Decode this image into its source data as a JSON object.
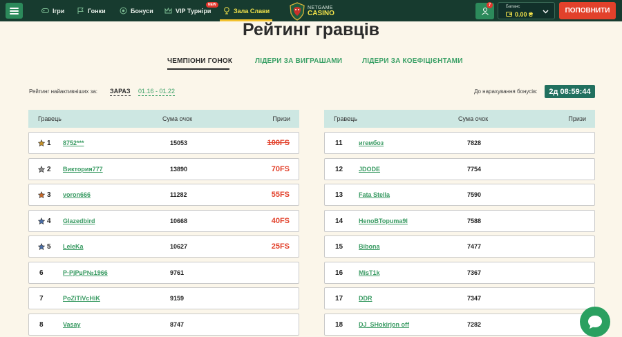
{
  "nav": {
    "items": [
      {
        "label": "Ігри",
        "icon": "gamepad-icon"
      },
      {
        "label": "Гонки",
        "icon": "flag-icon"
      },
      {
        "label": "Бонуси",
        "icon": "bonus-icon"
      },
      {
        "label": "VIP Турніри",
        "icon": "crown-icon",
        "badge": "NEW"
      },
      {
        "label": "Зала Слави",
        "icon": "trophy-icon",
        "active": true
      }
    ]
  },
  "logo": {
    "line1": "NETGAME",
    "line2": "CASINO"
  },
  "user": {
    "notifications": "7"
  },
  "balance": {
    "label": "Баланс",
    "value": "0.00 ₴"
  },
  "deposit_label": "ПОПОВНИТИ",
  "page_title": "Рейтинг гравців",
  "tabs": [
    "ЧЕМПІОНИ ГОНОК",
    "ЛІДЕРИ ЗА ВИГРАШАМИ",
    "ЛІДЕРИ ЗА КОЕФІЦІЄНТАМИ"
  ],
  "filter": {
    "label": "Рейтинг найактивніших за:",
    "now": "ЗАРАЗ",
    "range": "01.16 - 01.22"
  },
  "bonus": {
    "label": "До нарахування бонусів:",
    "timer": "2д 08:59:44"
  },
  "table_headers": {
    "player": "Гравець",
    "points": "Сума очок",
    "prizes": "Призи"
  },
  "left_rows": [
    {
      "rank": "1",
      "name": "8752***",
      "points": "15053",
      "prize": "100FS",
      "medal": "#c6932b",
      "strike": true
    },
    {
      "rank": "2",
      "name": "Виктория777",
      "points": "13890",
      "prize": "70FS",
      "medal": "#8a8a8a"
    },
    {
      "rank": "3",
      "name": "voron666",
      "points": "11282",
      "prize": "55FS",
      "medal": "#c66a2b"
    },
    {
      "rank": "4",
      "name": "Glazedbird",
      "points": "10668",
      "prize": "40FS",
      "medal": "#4a6fa8"
    },
    {
      "rank": "5",
      "name": "LeleKa",
      "points": "10627",
      "prize": "25FS",
      "medal": "#4a6fa8"
    },
    {
      "rank": "6",
      "name": "Р·РјРµР№1966",
      "points": "9761",
      "prize": ""
    },
    {
      "rank": "7",
      "name": "PoZiTiVcHiK",
      "points": "9159",
      "prize": ""
    },
    {
      "rank": "8",
      "name": "Vasay",
      "points": "8747",
      "prize": ""
    }
  ],
  "right_rows": [
    {
      "rank": "11",
      "name": "игембоз",
      "points": "7828"
    },
    {
      "rank": "12",
      "name": "JDODE",
      "points": "7754"
    },
    {
      "rank": "13",
      "name": "Fata Stella",
      "points": "7590"
    },
    {
      "rank": "14",
      "name": "HenoBTopuma9l",
      "points": "7588"
    },
    {
      "rank": "15",
      "name": "Bibona",
      "points": "7477"
    },
    {
      "rank": "16",
      "name": "MisT1k",
      "points": "7367"
    },
    {
      "rank": "17",
      "name": "DDR",
      "points": "7347"
    },
    {
      "rank": "18",
      "name": "DJ_SHokirjon off",
      "points": "7282"
    }
  ]
}
